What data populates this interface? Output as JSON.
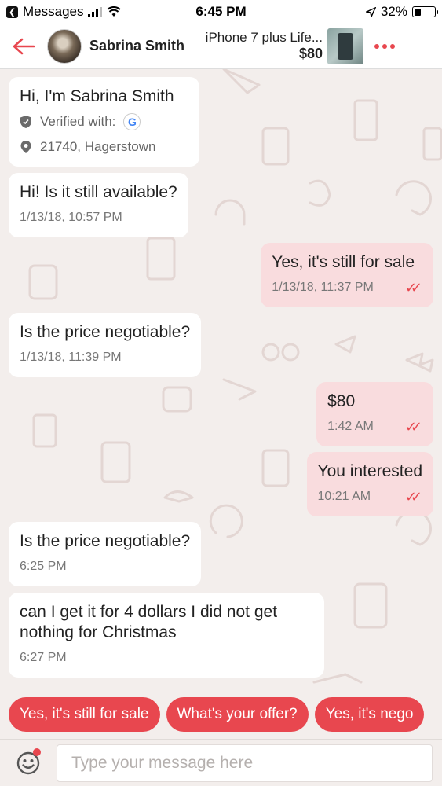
{
  "status_bar": {
    "back_app": "Messages",
    "time": "6:45 PM",
    "battery": "32%",
    "battery_level": 0.32
  },
  "header": {
    "contact_name": "Sabrina Smith",
    "listing_title": "iPhone 7 plus Life...",
    "listing_price": "$80",
    "accent_color": "#e8474f"
  },
  "profile_card": {
    "greeting": "Hi, I'm Sabrina Smith",
    "verified_label": "Verified with:",
    "verified_provider_icon": "google-icon",
    "location": "21740, Hagerstown"
  },
  "messages": [
    {
      "direction": "in",
      "text": "Hi! Is it still available?",
      "time": "1/13/18, 10:57 PM"
    },
    {
      "direction": "out",
      "text": "Yes, it's still for sale",
      "time": "1/13/18, 11:37 PM",
      "status": "read"
    },
    {
      "direction": "in",
      "text": "Is the price negotiable?",
      "time": "1/13/18, 11:39 PM"
    },
    {
      "direction": "out",
      "text": "$80",
      "time": "1:42 AM",
      "status": "read"
    },
    {
      "direction": "out",
      "text": "You interested",
      "time": "10:21 AM",
      "status": "read"
    },
    {
      "direction": "in",
      "text": "Is the price negotiable?",
      "time": "6:25 PM"
    },
    {
      "direction": "in",
      "text": "can I get it for 4 dollars I did not get nothing for Christmas",
      "time": "6:27 PM"
    }
  ],
  "quick_replies": [
    "Yes, it's still for sale",
    "What's your offer?",
    "Yes, it's nego"
  ],
  "composer": {
    "placeholder": "Type your message here"
  }
}
